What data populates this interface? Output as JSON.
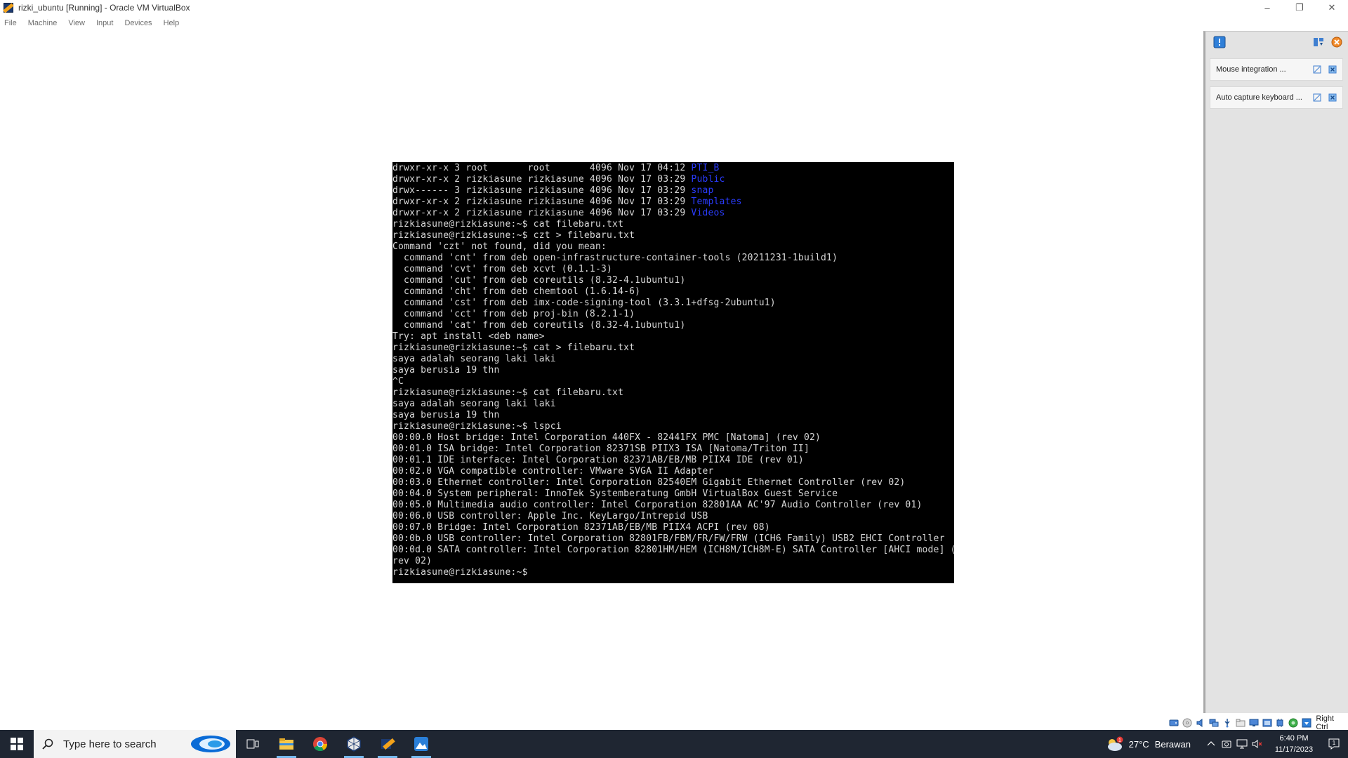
{
  "window": {
    "title": "rizki_ubuntu [Running] - Oracle VM VirtualBox",
    "minimize": "–",
    "restore": "❐",
    "close": "✕"
  },
  "menu": [
    "File",
    "Machine",
    "View",
    "Input",
    "Devices",
    "Help"
  ],
  "terminal": {
    "lines": [
      {
        "text": "drwxr-xr-x 3 root       root       4096 Nov 17 04:12 ",
        "dir": "PTI_B"
      },
      {
        "text": "drwxr-xr-x 2 rizkiasune rizkiasune 4096 Nov 17 03:29 ",
        "dir": "Public"
      },
      {
        "text": "drwx------ 3 rizkiasune rizkiasune 4096 Nov 17 03:29 ",
        "dir": "snap"
      },
      {
        "text": "drwxr-xr-x 2 rizkiasune rizkiasune 4096 Nov 17 03:29 ",
        "dir": "Templates"
      },
      {
        "text": "drwxr-xr-x 2 rizkiasune rizkiasune 4096 Nov 17 03:29 ",
        "dir": "Videos"
      },
      {
        "text": "rizkiasune@rizkiasune:~$ cat filebaru.txt"
      },
      {
        "text": "rizkiasune@rizkiasune:~$ czt > filebaru.txt"
      },
      {
        "text": "Command 'czt' not found, did you mean:"
      },
      {
        "text": "  command 'cnt' from deb open-infrastructure-container-tools (20211231-1build1)"
      },
      {
        "text": "  command 'cvt' from deb xcvt (0.1.1-3)"
      },
      {
        "text": "  command 'cut' from deb coreutils (8.32-4.1ubuntu1)"
      },
      {
        "text": "  command 'cht' from deb chemtool (1.6.14-6)"
      },
      {
        "text": "  command 'cst' from deb imx-code-signing-tool (3.3.1+dfsg-2ubuntu1)"
      },
      {
        "text": "  command 'cct' from deb proj-bin (8.2.1-1)"
      },
      {
        "text": "  command 'cat' from deb coreutils (8.32-4.1ubuntu1)"
      },
      {
        "text": "Try: apt install <deb name>"
      },
      {
        "text": "rizkiasune@rizkiasune:~$ cat > filebaru.txt"
      },
      {
        "text": "saya adalah seorang laki laki"
      },
      {
        "text": "saya berusia 19 thn"
      },
      {
        "text": "^C"
      },
      {
        "text": "rizkiasune@rizkiasune:~$ cat filebaru.txt"
      },
      {
        "text": "saya adalah seorang laki laki"
      },
      {
        "text": "saya berusia 19 thn"
      },
      {
        "text": "rizkiasune@rizkiasune:~$ lspci"
      },
      {
        "text": "00:00.0 Host bridge: Intel Corporation 440FX - 82441FX PMC [Natoma] (rev 02)"
      },
      {
        "text": "00:01.0 ISA bridge: Intel Corporation 82371SB PIIX3 ISA [Natoma/Triton II]"
      },
      {
        "text": "00:01.1 IDE interface: Intel Corporation 82371AB/EB/MB PIIX4 IDE (rev 01)"
      },
      {
        "text": "00:02.0 VGA compatible controller: VMware SVGA II Adapter"
      },
      {
        "text": "00:03.0 Ethernet controller: Intel Corporation 82540EM Gigabit Ethernet Controller (rev 02)"
      },
      {
        "text": "00:04.0 System peripheral: InnoTek Systemberatung GmbH VirtualBox Guest Service"
      },
      {
        "text": "00:05.0 Multimedia audio controller: Intel Corporation 82801AA AC'97 Audio Controller (rev 01)"
      },
      {
        "text": "00:06.0 USB controller: Apple Inc. KeyLargo/Intrepid USB"
      },
      {
        "text": "00:07.0 Bridge: Intel Corporation 82371AB/EB/MB PIIX4 ACPI (rev 08)"
      },
      {
        "text": "00:0b.0 USB controller: Intel Corporation 82801FB/FBM/FR/FW/FRW (ICH6 Family) USB2 EHCI Controller"
      },
      {
        "text": "00:0d.0 SATA controller: Intel Corporation 82801HM/HEM (ICH8M/ICH8M-E) SATA Controller [AHCI mode] ("
      },
      {
        "text": "rev 02)"
      },
      {
        "text": "rizkiasune@rizkiasune:~$"
      }
    ]
  },
  "notifications": [
    {
      "label": "Mouse integration ..."
    },
    {
      "label": "Auto capture keyboard ..."
    }
  ],
  "statusbar": {
    "host_key": "Right Ctrl",
    "icons": [
      "hard-disk-icon",
      "optical-drive-icon",
      "audio-icon",
      "network-icon",
      "usb-icon",
      "shared-folders-icon",
      "display-icon",
      "video-capture-icon",
      "cpu-icon",
      "recording-icon",
      "arrow-down-icon"
    ]
  },
  "taskbar": {
    "search_placeholder": "Type here to search",
    "apps": [
      "task-view-icon",
      "file-explorer-icon",
      "chrome-icon",
      "virtualbox-icon",
      "virtualbox-vm-icon",
      "photos-icon"
    ],
    "weather_temp": "27°C",
    "weather_desc": "Berawan",
    "weather_badge": "1",
    "time": "6:40 PM",
    "date": "11/17/2023",
    "notif_count": "1"
  },
  "colors": {
    "terminal_bg": "#000000",
    "terminal_fg": "#d8d8d8",
    "terminal_dir": "#2a3cff",
    "taskbar_bg": "#1f2632",
    "accent": "#76b9ed"
  }
}
